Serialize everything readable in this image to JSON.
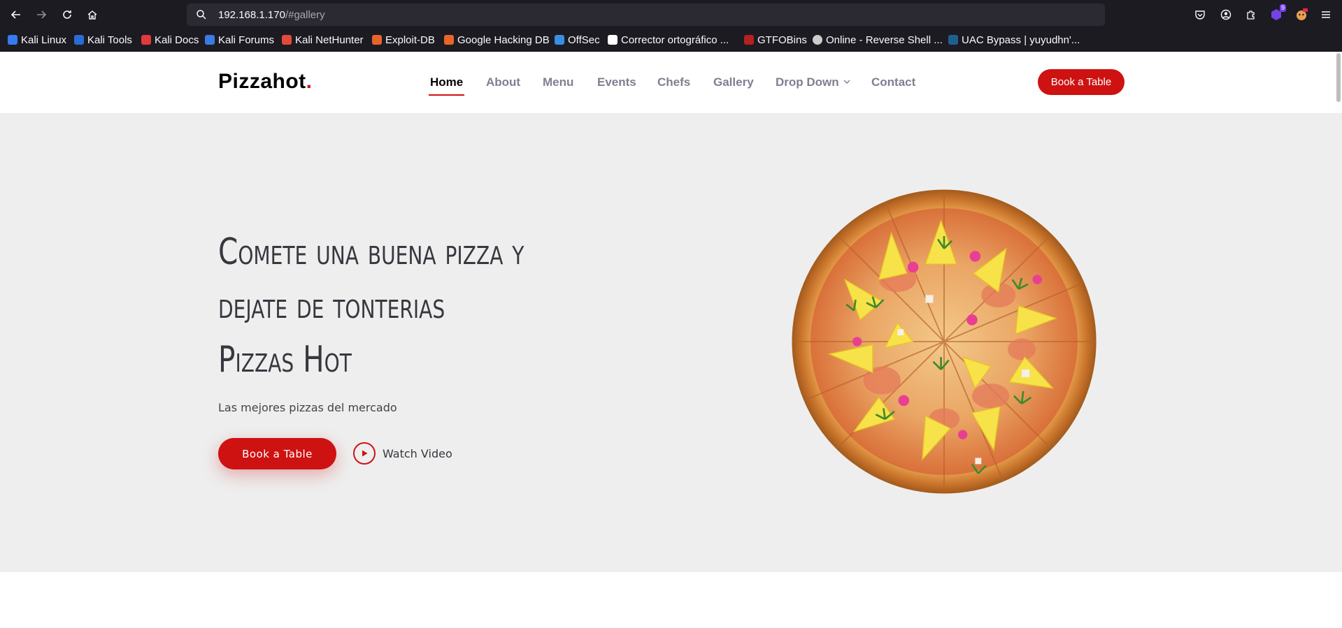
{
  "browser": {
    "url_host": "192.168.1.170",
    "url_path": "/#gallery",
    "extensions_badge": "9",
    "bookmarks": [
      {
        "label": "Kali Linux",
        "color": "#367bf0"
      },
      {
        "label": "Kali Tools",
        "color": "#2b6bd6"
      },
      {
        "label": "Kali Docs",
        "color": "#e23a3a"
      },
      {
        "label": "Kali Forums",
        "color": "#3a7be2"
      },
      {
        "label": "Kali NetHunter",
        "color": "#e24b3a"
      },
      {
        "label": "Exploit-DB",
        "color": "#e8642c"
      },
      {
        "label": "Google Hacking DB",
        "color": "#e8642c"
      },
      {
        "label": "OffSec",
        "color": "#3a8ee2"
      },
      {
        "label": "Corrector ortográfico ...",
        "color": "#ffffff"
      },
      {
        "label": "GTFOBins",
        "color": "#b52020"
      },
      {
        "label": "Online - Reverse Shell ...",
        "color": "#cccccc"
      },
      {
        "label": "UAC Bypass | yuyudhn'...",
        "color": "#1f5f8f"
      }
    ]
  },
  "header": {
    "logo": "Pizzahot",
    "logo_dot": ".",
    "nav": [
      "Home",
      "About",
      "Menu",
      "Events",
      "Chefs",
      "Gallery",
      "Drop Down",
      "Contact"
    ],
    "book_label": "Book a Table"
  },
  "hero": {
    "title_lines": [
      "Comete una buena pizza y",
      "dejate de tonterias",
      "Pizzas Hot"
    ],
    "subtitle": "Las mejores pizzas del mercado",
    "book_label": "Book a Table",
    "watch_label": "Watch Video"
  },
  "colors": {
    "accent": "#ce1212",
    "hero_bg": "#eeeeee",
    "chrome_bg": "#1c1b22"
  }
}
